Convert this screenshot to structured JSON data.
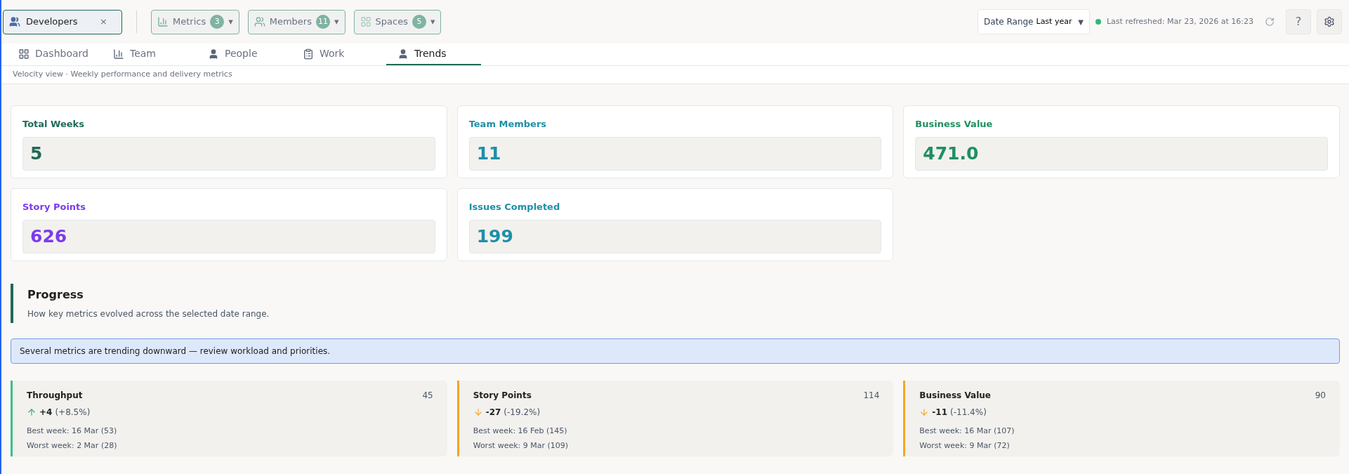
{
  "filter_bar": {
    "team_chip": {
      "label": "Developers",
      "close": "×"
    },
    "filters": [
      {
        "kind": "metrics",
        "label": "Metrics",
        "count": "3",
        "caret": "▾"
      },
      {
        "kind": "members",
        "label": "Members",
        "count": "11",
        "caret": "▾"
      },
      {
        "kind": "spaces",
        "label": "Spaces",
        "count": "5",
        "caret": "▾"
      }
    ],
    "date_range": {
      "label": "Date Range",
      "value": "Last year",
      "caret": "▼"
    },
    "refresh_status": "Last refreshed: Mar 23, 2026 at 16:23",
    "help": "?"
  },
  "tabs": [
    {
      "kind": "dashboard",
      "label": "Dashboard",
      "selected": false
    },
    {
      "kind": "team",
      "label": "Team",
      "selected": false
    },
    {
      "kind": "people",
      "label": "People",
      "selected": false
    },
    {
      "kind": "work",
      "label": "Work",
      "selected": false
    },
    {
      "kind": "person",
      "label": "Trends",
      "selected": true
    }
  ],
  "subtitle": "Velocity view · Weekly performance and delivery metrics",
  "stats": [
    {
      "label": "Total Weeks",
      "value": "5",
      "color": "#1f6b57"
    },
    {
      "label": "Team Members",
      "value": "11",
      "color": "#1f8fa8"
    },
    {
      "label": "Business Value",
      "value": "471.0",
      "color": "#1f8f63"
    },
    {
      "label": "Story Points",
      "value": "626",
      "color": "#7c3aed"
    },
    {
      "label": "Issues Completed",
      "value": "199",
      "color": "#1f8fa8"
    }
  ],
  "progress": {
    "title": "Progress",
    "description": "How key metrics evolved across the selected date range.",
    "alert": "Several metrics are trending downward — review workload and priorities.",
    "trends": [
      {
        "name": "Throughput",
        "total": "45",
        "kind": "up",
        "delta": "+4",
        "percent": "(+8.5%)",
        "best": "Best week: 16 Mar (53)",
        "worst": "Worst week: 2 Mar (28)"
      },
      {
        "name": "Story Points",
        "total": "114",
        "kind": "down",
        "delta": "-27",
        "percent": "(-19.2%)",
        "best": "Best week: 16 Feb (145)",
        "worst": "Worst week: 9 Mar (109)"
      },
      {
        "name": "Business Value",
        "total": "90",
        "kind": "down",
        "delta": "-11",
        "percent": "(-11.4%)",
        "best": "Best week: 16 Mar (107)",
        "worst": "Worst week: 9 Mar (72)"
      }
    ]
  }
}
